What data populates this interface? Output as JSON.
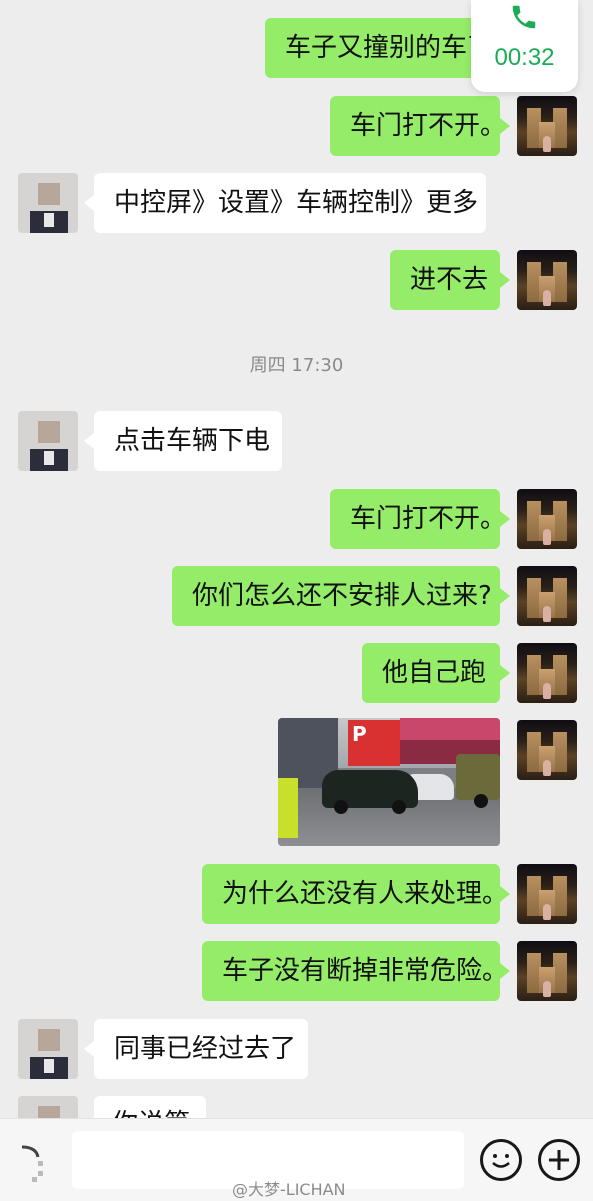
{
  "call": {
    "duration": "00:32",
    "icon": "phone-icon",
    "color": "#1aad55"
  },
  "messages": [
    {
      "side": "right",
      "text": "车子又撞别的车了。"
    },
    {
      "side": "right",
      "text": "车门打不开。"
    },
    {
      "side": "left",
      "text": "中控屏》设置》车辆控制》更多"
    },
    {
      "side": "right",
      "text": "进不去"
    },
    {
      "side": "left",
      "text": "点击车辆下电"
    },
    {
      "side": "right",
      "text": "车门打不开。"
    },
    {
      "side": "right",
      "text": "你们怎么还不安排人过来?"
    },
    {
      "side": "right",
      "text": "他自己跑"
    },
    {
      "side": "right",
      "type": "image"
    },
    {
      "side": "right",
      "text": "为什么还没有人来处理。"
    },
    {
      "side": "right",
      "text": "车子没有断掉非常危险。"
    },
    {
      "side": "left",
      "text": "同事已经过去了"
    },
    {
      "side": "left",
      "text": "你说第"
    }
  ],
  "timestamp": "周四 17:30",
  "photo": {
    "sign_letter": "P"
  },
  "input": {
    "placeholder": "",
    "value": ""
  },
  "icons": {
    "voice": "voice-icon",
    "emoji": "emoji-icon",
    "plus": "plus-icon"
  },
  "watermark": "@大梦-LICHAN",
  "colors": {
    "sent_bubble": "#95ec69",
    "received_bubble": "#ffffff",
    "background": "#ededed"
  }
}
